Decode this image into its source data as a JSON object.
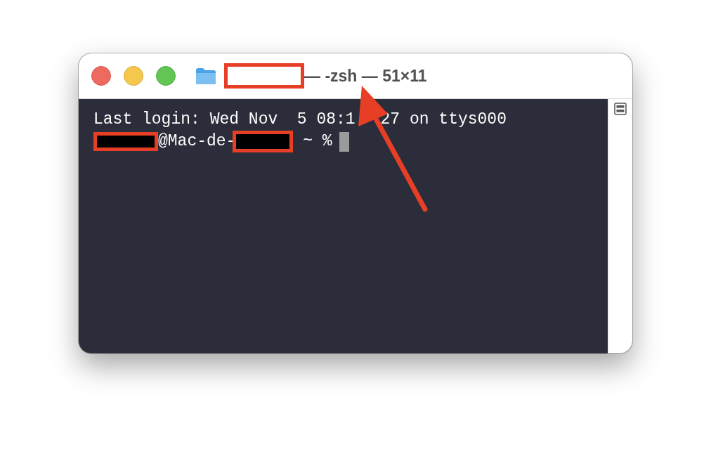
{
  "window": {
    "title_parts": [
      {
        "kind": "redaction"
      },
      {
        "kind": "text",
        "text": "— -zsh — 51×11"
      }
    ]
  },
  "terminal": {
    "lines": [
      {
        "parts": [
          {
            "kind": "text",
            "text": "Last login: Wed Nov  5 08:1"
          },
          {
            "kind": "covered"
          },
          {
            "kind": "text",
            "text": "27 on ttys000"
          }
        ]
      },
      {
        "parts": [
          {
            "kind": "redaction"
          },
          {
            "kind": "text",
            "text": "@Mac-de-"
          },
          {
            "kind": "redaction"
          },
          {
            "kind": "text",
            "text": " ~ %"
          },
          {
            "kind": "cursor"
          }
        ]
      }
    ]
  },
  "annotations": [
    {
      "kind": "arrow"
    }
  ]
}
